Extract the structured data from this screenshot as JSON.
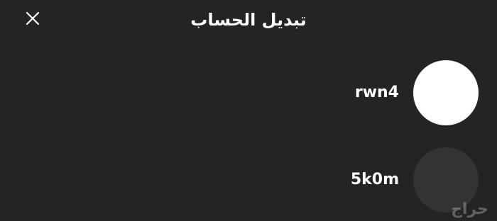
{
  "header": {
    "title": "تبديل الحساب",
    "close_icon": "close-icon"
  },
  "accounts": [
    {
      "username": "rwn4",
      "avatar_color": "#ffffff"
    },
    {
      "username": "5k0m",
      "avatar_color": "#333333"
    }
  ],
  "watermark": "حراج",
  "colors": {
    "background": "#242424",
    "text": "#ffffff"
  }
}
